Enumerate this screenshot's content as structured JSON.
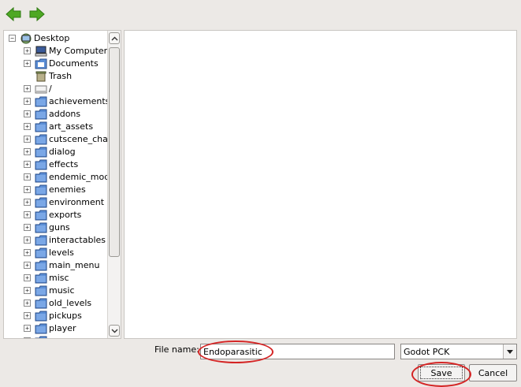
{
  "toolbar": {
    "back_icon": "back-arrow-icon",
    "forward_icon": "forward-arrow-icon",
    "arrow_color": "#4ea824"
  },
  "tree": {
    "items": [
      {
        "label": "Desktop",
        "icon": "desktop-icon",
        "level": 0,
        "expander": "−"
      },
      {
        "label": "My Computer",
        "icon": "computer-icon",
        "level": 1,
        "expander": "+"
      },
      {
        "label": "Documents",
        "icon": "documents-icon",
        "level": 1,
        "expander": "+"
      },
      {
        "label": "Trash",
        "icon": "trash-icon",
        "level": 1,
        "expander": ""
      },
      {
        "label": "/",
        "icon": "drive-icon",
        "level": 1,
        "expander": "+"
      },
      {
        "label": "achievements",
        "icon": "folder-icon",
        "level": 1,
        "expander": "+"
      },
      {
        "label": "addons",
        "icon": "folder-icon",
        "level": 1,
        "expander": "+"
      },
      {
        "label": "art_assets",
        "icon": "folder-icon",
        "level": 1,
        "expander": "+"
      },
      {
        "label": "cutscene_chara",
        "icon": "folder-icon",
        "level": 1,
        "expander": "+"
      },
      {
        "label": "dialog",
        "icon": "folder-icon",
        "level": 1,
        "expander": "+"
      },
      {
        "label": "effects",
        "icon": "folder-icon",
        "level": 1,
        "expander": "+"
      },
      {
        "label": "endemic_mode",
        "icon": "folder-icon",
        "level": 1,
        "expander": "+"
      },
      {
        "label": "enemies",
        "icon": "folder-icon",
        "level": 1,
        "expander": "+"
      },
      {
        "label": "environment",
        "icon": "folder-icon",
        "level": 1,
        "expander": "+"
      },
      {
        "label": "exports",
        "icon": "folder-icon",
        "level": 1,
        "expander": "+"
      },
      {
        "label": "guns",
        "icon": "folder-icon",
        "level": 1,
        "expander": "+"
      },
      {
        "label": "interactables",
        "icon": "folder-icon",
        "level": 1,
        "expander": "+"
      },
      {
        "label": "levels",
        "icon": "folder-icon",
        "level": 1,
        "expander": "+"
      },
      {
        "label": "main_menu",
        "icon": "folder-icon",
        "level": 1,
        "expander": "+"
      },
      {
        "label": "misc",
        "icon": "folder-icon",
        "level": 1,
        "expander": "+"
      },
      {
        "label": "music",
        "icon": "folder-icon",
        "level": 1,
        "expander": "+"
      },
      {
        "label": "old_levels",
        "icon": "folder-icon",
        "level": 1,
        "expander": "+"
      },
      {
        "label": "pickups",
        "icon": "folder-icon",
        "level": 1,
        "expander": "+"
      },
      {
        "label": "player",
        "icon": "folder-icon",
        "level": 1,
        "expander": "+"
      },
      {
        "label": "",
        "icon": "folder-icon",
        "level": 1,
        "expander": "+"
      }
    ]
  },
  "file_name": {
    "label": "File name:",
    "value": "Endoparasitic"
  },
  "file_type": {
    "selected": "Godot PCK"
  },
  "buttons": {
    "save": "Save",
    "cancel": "Cancel"
  },
  "colors": {
    "annotation": "#d42424",
    "folder": "#5b8ed6"
  }
}
